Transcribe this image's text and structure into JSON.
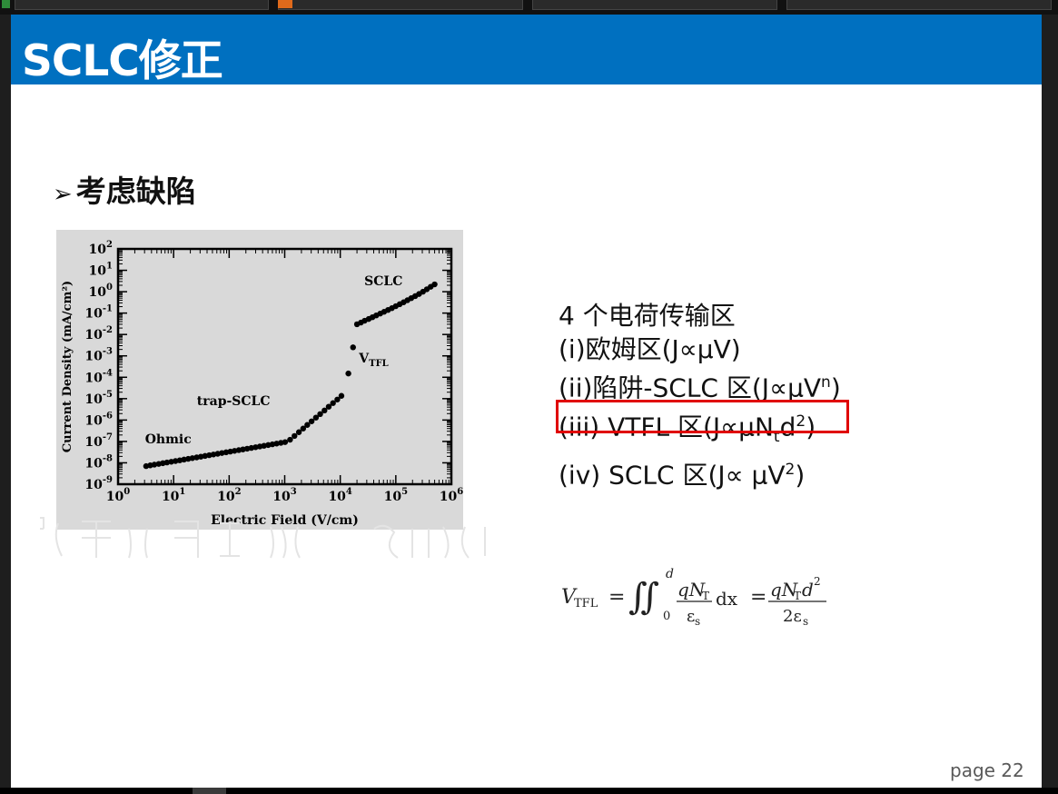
{
  "slide": {
    "title": "SCLC修正",
    "bullet_arrow": "➢",
    "bullet_text": "考虑缺陷",
    "page_label": "page 22"
  },
  "regions": {
    "heading": "4 个电荷传输区",
    "r1": "(i)欧姆区(J∝μV)",
    "r2_main": "(ii)陷阱-SCLC 区(J∝μV",
    "r2_sup": "n",
    "r2_end": ")",
    "r3_main": "(iii) VTFL 区(J∝μN",
    "r3_sub": "t",
    "r3_mid": "d",
    "r3_sup": "2",
    "r3_end": ")",
    "r4_main": "(iv) SCLC 区(J∝ μV",
    "r4_sup": "2",
    "r4_end": ")"
  },
  "formula": {
    "lhs": "V",
    "lhs_sub": "TFL",
    "eq1": "=",
    "integral": "∬",
    "upper": "d",
    "lower": "0",
    "num1": "qN",
    "num1_sub": "T",
    "den1": "ε",
    "den1_sub": "s",
    "dx": "dx",
    "eq2": "=",
    "num2": "qN",
    "num2_sub": "T",
    "num2_tail": "d",
    "num2_sup": "2",
    "den2": "2ε",
    "den2_sub": "s"
  },
  "colors": {
    "title_bar": "#0070c0",
    "highlight_box": "#e00000",
    "chart_bg": "#d9d9d9"
  },
  "chart_data": {
    "type": "scatter",
    "xlabel": "Electric Field (V/cm)",
    "ylabel": "Current Density (mA/cm²)",
    "xscale": "log",
    "yscale": "log",
    "xlim": [
      1,
      1000000
    ],
    "ylim": [
      1e-09,
      100
    ],
    "x_ticks": [
      "10^0",
      "10^1",
      "10^2",
      "10^3",
      "10^4",
      "10^5",
      "10^6"
    ],
    "y_ticks": [
      "10^2",
      "10^1",
      "10^0",
      "10^-1",
      "10^-2",
      "10^-3",
      "10^-4",
      "10^-5",
      "10^-6",
      "10^-7",
      "10^-8",
      "10^-9"
    ],
    "annotations": [
      {
        "text": "SCLC",
        "x": 60000,
        "y": 2
      },
      {
        "text": "V",
        "sub": "TFL",
        "x": 40000,
        "y": 0.0005
      },
      {
        "text": "trap-SCLC",
        "x": 120,
        "y": 5e-06
      },
      {
        "text": "Ohmic",
        "x": 8,
        "y": 8e-08
      }
    ],
    "series": [
      {
        "points": [
          [
            3.2,
            7e-09
          ],
          [
            3.8,
            7.6e-09
          ],
          [
            4.5,
            8.2e-09
          ],
          [
            5.4,
            8.9e-09
          ],
          [
            6.4,
            9.6e-09
          ],
          [
            7.6,
            1.04e-08
          ],
          [
            9.1,
            1.12e-08
          ],
          [
            10.8,
            1.21e-08
          ],
          [
            12.9,
            1.31e-08
          ],
          [
            15.4,
            1.42e-08
          ],
          [
            18.3,
            1.53e-08
          ],
          [
            21.8,
            1.66e-08
          ],
          [
            26,
            1.79e-08
          ],
          [
            30.9,
            1.94e-08
          ],
          [
            36.8,
            2.1e-08
          ],
          [
            43.8,
            2.27e-08
          ],
          [
            52.2,
            2.45e-08
          ],
          [
            62.2,
            2.65e-08
          ],
          [
            74,
            2.87e-08
          ],
          [
            88.2,
            3.1e-08
          ],
          [
            105,
            3.35e-08
          ],
          [
            125,
            3.62e-08
          ],
          [
            149,
            3.92e-08
          ],
          [
            177,
            4.24e-08
          ],
          [
            211,
            4.58e-08
          ],
          [
            251,
            4.96e-08
          ],
          [
            299,
            5.36e-08
          ],
          [
            356,
            5.8e-08
          ],
          [
            424,
            6.27e-08
          ],
          [
            505,
            6.78e-08
          ],
          [
            601,
            7.33e-08
          ],
          [
            716,
            7.93e-08
          ],
          [
            853,
            8.58e-08
          ],
          [
            1015,
            9.28e-08
          ]
        ]
      },
      {
        "points": [
          [
            1250,
            1.2e-07
          ],
          [
            1500,
            1.8e-07
          ],
          [
            1800,
            2.7e-07
          ],
          [
            2150,
            4e-07
          ],
          [
            2550,
            5.9e-07
          ],
          [
            3050,
            8.7e-07
          ],
          [
            3650,
            1.3e-06
          ],
          [
            4350,
            1.9e-06
          ],
          [
            5200,
            2.8e-06
          ],
          [
            6200,
            4.2e-06
          ],
          [
            7400,
            6.2e-06
          ],
          [
            8850,
            9.1e-06
          ],
          [
            10500,
            1.35e-05
          ]
        ]
      },
      {
        "points": [
          [
            14000,
            0.00015
          ],
          [
            17000,
            0.0025
          ]
        ]
      },
      {
        "points": [
          [
            20000,
            0.03
          ],
          [
            23500,
            0.036
          ],
          [
            27500,
            0.044
          ],
          [
            32500,
            0.053
          ],
          [
            38000,
            0.064
          ],
          [
            44500,
            0.078
          ],
          [
            52500,
            0.095
          ],
          [
            61500,
            0.115
          ],
          [
            72500,
            0.14
          ],
          [
            85000,
            0.17
          ],
          [
            100000,
            0.21
          ],
          [
            117500,
            0.26
          ],
          [
            138000,
            0.32
          ],
          [
            162000,
            0.4
          ],
          [
            190000,
            0.5
          ],
          [
            223000,
            0.62
          ],
          [
            262000,
            0.78
          ],
          [
            308000,
            1
          ],
          [
            362000,
            1.3
          ],
          [
            425000,
            1.7
          ],
          [
            500000,
            2.2
          ]
        ]
      }
    ]
  }
}
